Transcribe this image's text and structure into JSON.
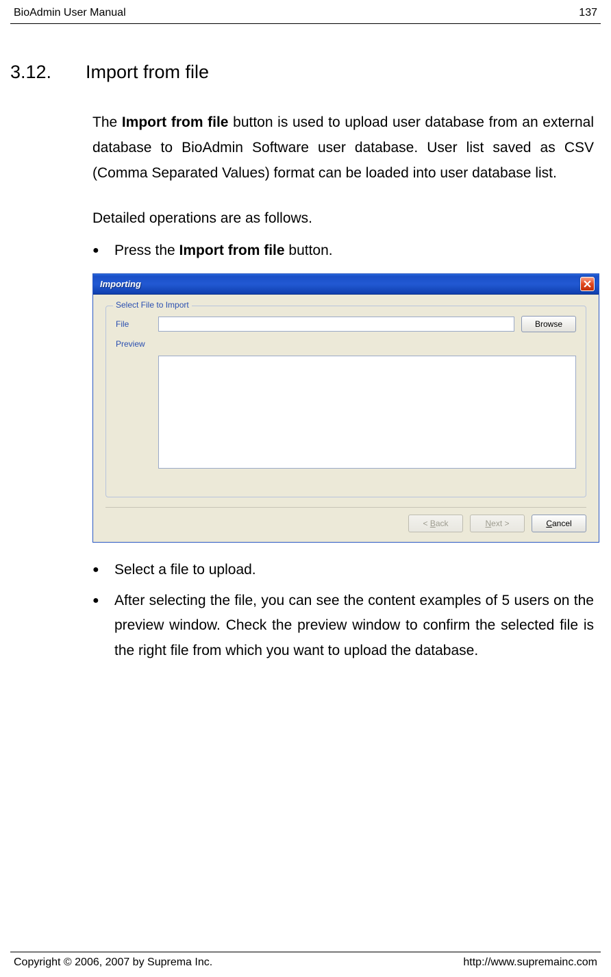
{
  "header": {
    "doc_title": "BioAdmin  User  Manual",
    "page_number": "137"
  },
  "footer": {
    "copyright": "Copyright © 2006, 2007 by Suprema Inc.",
    "url": "http://www.supremainc.com"
  },
  "section": {
    "number": "3.12.",
    "title": "Import from file"
  },
  "body": {
    "intro_1": "The ",
    "intro_bold": "Import from file",
    "intro_2": " button is used to upload user database from an external database to BioAdmin Software user database. User list saved as CSV (Comma Separated Values) format can be loaded into user database list.",
    "detailed": "Detailed operations are as follows.",
    "bullet1_a": "Press the ",
    "bullet1_bold": "Import from file",
    "bullet1_b": " button.",
    "bullet2": "Select a file to upload.",
    "bullet3": "After selecting the file, you can see the content examples of 5 users on the preview window. Check the preview window to confirm the selected file is the right file from which you want to upload the database."
  },
  "dialog": {
    "title": "Importing",
    "group_legend": "Select File to Import",
    "file_label": "File",
    "preview_label": "Preview",
    "browse": "Browse",
    "back_prefix": "< ",
    "back_u": "B",
    "back_suffix": "ack",
    "next_u": "N",
    "next_suffix": "ext >",
    "cancel_u": "C",
    "cancel_suffix": "ancel"
  }
}
